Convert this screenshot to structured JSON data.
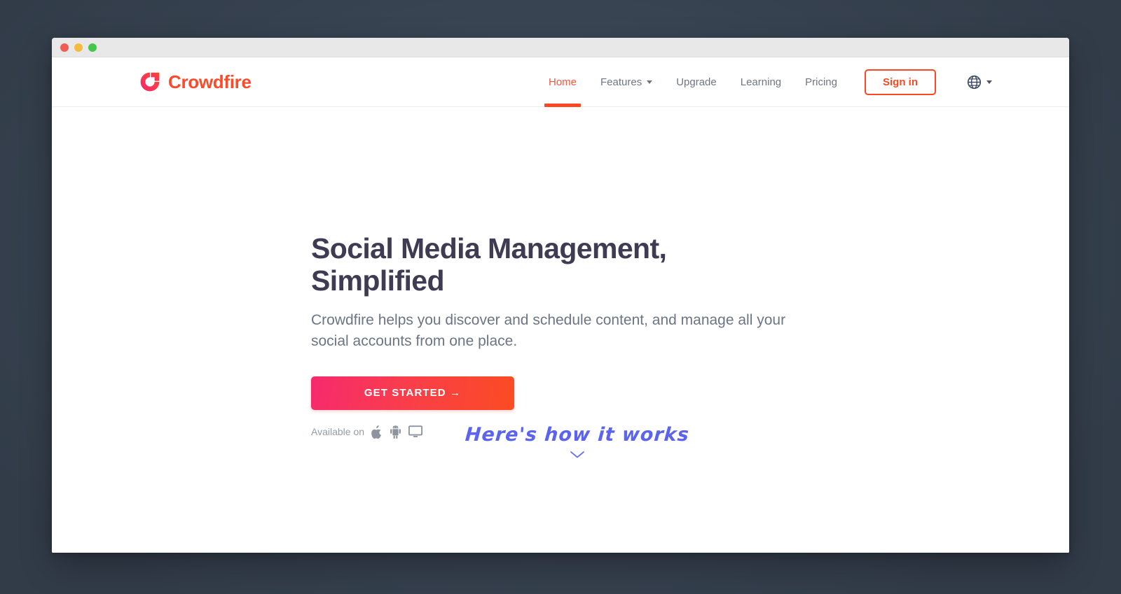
{
  "window": {
    "traffic_lights": [
      "close",
      "minimize",
      "maximize"
    ],
    "colors": {
      "close": "#f15c52",
      "minimize": "#f5bb3f",
      "maximize": "#43c84b"
    }
  },
  "brand": {
    "name": "Crowdfire",
    "logo_icon": "crowdfire-logo-icon",
    "color": "#fa4b2a"
  },
  "nav": {
    "items": [
      {
        "label": "Home",
        "active": true,
        "has_dropdown": false
      },
      {
        "label": "Features",
        "active": false,
        "has_dropdown": true
      },
      {
        "label": "Upgrade",
        "active": false,
        "has_dropdown": false
      },
      {
        "label": "Learning",
        "active": false,
        "has_dropdown": false
      },
      {
        "label": "Pricing",
        "active": false,
        "has_dropdown": false
      }
    ],
    "active_color": "#fa5540",
    "inactive_color": "#6d7681"
  },
  "actions": {
    "signin_label": "Sign in",
    "signin_color": "#fb4820",
    "language_icon": "globe-icon",
    "language_caret": "chevron-down-icon"
  },
  "hero": {
    "title_line1": "Social Media Management,",
    "title_line2": "Simplified",
    "title_color": "#3e3b52",
    "subtitle": "Crowdfire helps you discover and schedule content, and manage all your social accounts from one place.",
    "cta_label": "GET STARTED →",
    "cta_gradient_start": "#f62a6e",
    "cta_gradient_end": "#fb4c22",
    "availability_label": "Available on",
    "platforms": [
      {
        "name": "apple-icon"
      },
      {
        "name": "android-icon"
      },
      {
        "name": "desktop-icon"
      }
    ],
    "how_it_works": "Here's how it works",
    "how_it_works_color": "#5b63ef",
    "scroll_icon": "chevron-down-icon"
  },
  "background": {
    "color": "#3c4857"
  }
}
